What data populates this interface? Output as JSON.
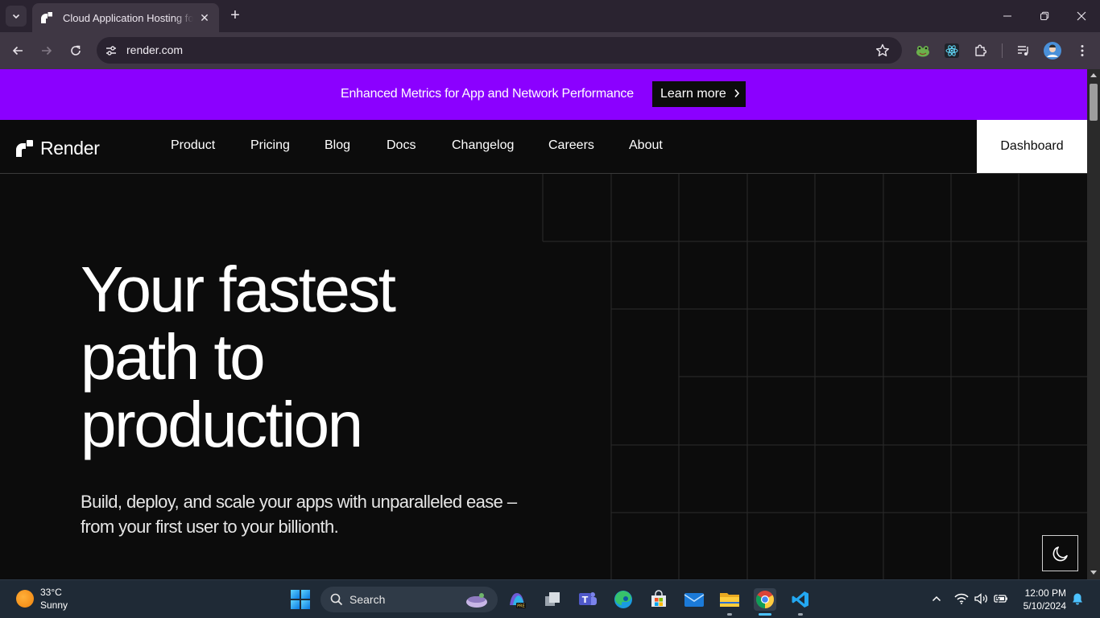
{
  "browser": {
    "tab": {
      "title": "Cloud Application Hosting for Developers | Render",
      "favicon": "render-logo-icon"
    },
    "url": "render.com",
    "icons": {
      "tab_list": "chevron-down-icon",
      "new_tab": "plus-icon",
      "back": "arrow-left-icon",
      "forward": "arrow-right-icon",
      "reload": "reload-icon",
      "site_info": "tune-icon",
      "bookmark": "star-icon",
      "extensions": [
        "frog-extension-icon",
        "react-devtools-icon",
        "puzzle-extensions-icon"
      ],
      "media": "media-controls-icon",
      "profile": "profile-avatar",
      "menu": "kebab-menu-icon"
    },
    "window_controls": [
      "minimize-icon",
      "restore-icon",
      "close-icon"
    ]
  },
  "banner": {
    "text": "Enhanced Metrics for App and Network Performance",
    "button_label": "Learn more",
    "background": "#8B00FF"
  },
  "nav": {
    "logo_text": "Render",
    "links": [
      "Product",
      "Pricing",
      "Blog",
      "Docs",
      "Changelog",
      "Careers",
      "About"
    ],
    "dashboard_label": "Dashboard"
  },
  "hero": {
    "title_lines": [
      "Your fastest",
      "path to",
      "production"
    ],
    "subtitle_lines": [
      "Build, deploy, and scale your apps with unparalleled ease –",
      "from your first user to your billionth."
    ],
    "theme_toggle_icon": "moon-icon"
  },
  "taskbar": {
    "weather": {
      "temp": "33°C",
      "condition": "Sunny"
    },
    "search_label": "Search",
    "apps": [
      "copilot-icon",
      "task-view-icon",
      "teams-icon",
      "edge-icon",
      "store-icon",
      "mail-icon",
      "file-explorer-icon",
      "chrome-icon",
      "vscode-icon"
    ],
    "tray": [
      "chevron-up-icon",
      "wifi-icon",
      "volume-icon",
      "battery-icon"
    ],
    "time": "12:00 PM",
    "date": "5/10/2024",
    "notification_icon": "bell-icon"
  }
}
